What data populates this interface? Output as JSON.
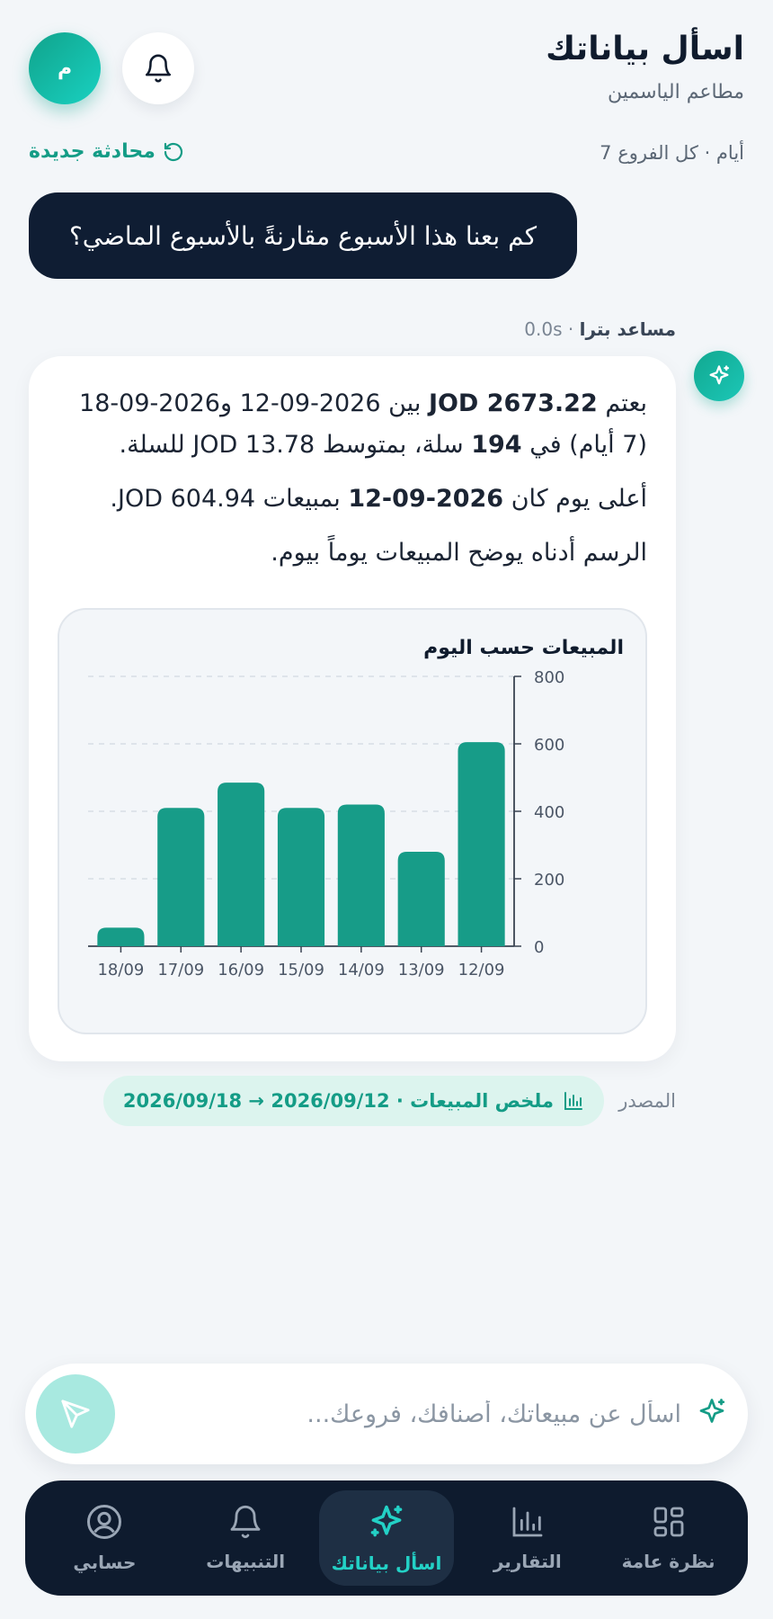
{
  "header": {
    "title": "اسأل بياناتك",
    "subtitle": "مطاعم الياسمين",
    "avatar_initial": "م"
  },
  "scope": "7 أيام · كل الفروع",
  "new_chat_label": "محادثة جديدة",
  "user_message": "كم بعنا هذا الأسبوع مقارنةً بالأسبوع الماضي؟",
  "assistant": {
    "name": "مساعد بترا",
    "latency": "0.0s",
    "p1_a": "بعتم",
    "p1_total": "JOD 2673.22",
    "p1_b": "بين 2026-09-12 و2026-09-18 (7 أيام) في",
    "p1_count": "194",
    "p1_c": "سلة، بمتوسط JOD 13.78 للسلة.",
    "p2_a": "أعلى يوم كان",
    "p2_date": "2026-09-12",
    "p2_b": "بمبيعات JOD 604.94.",
    "p3": "الرسم أدناه يوضح المبيعات يوماً بيوم."
  },
  "chart_data": {
    "type": "bar",
    "title": "المبيعات حسب اليوم",
    "categories": [
      "18/09",
      "17/09",
      "16/09",
      "15/09",
      "14/09",
      "13/09",
      "12/09"
    ],
    "values": [
      55,
      410,
      485,
      410,
      420,
      280,
      605
    ],
    "ylim": [
      0,
      800
    ],
    "yticks": [
      0,
      200,
      400,
      600,
      800
    ],
    "y_axis_side": "right",
    "grid": true,
    "bar_color": "#179c88"
  },
  "source": {
    "label": "المصدر",
    "chip_text": "ملخص المبيعات · 2026/09/12 → 2026/09/18"
  },
  "input": {
    "placeholder": "اسأل عن مبيعاتك، أصنافك، فروعك..."
  },
  "nav": {
    "items": [
      {
        "label": "نظرة عامة",
        "icon": "grid-icon"
      },
      {
        "label": "التقارير",
        "icon": "bar-chart-icon"
      },
      {
        "label": "اسأل بياناتك",
        "icon": "sparkle-icon",
        "active": true
      },
      {
        "label": "التنبيهات",
        "icon": "bell-icon"
      },
      {
        "label": "حسابي",
        "icon": "user-circle-icon"
      }
    ]
  },
  "colors": {
    "accent": "#149c86",
    "dark": "#0e1b2e",
    "active_nav": "#23d1c6"
  }
}
